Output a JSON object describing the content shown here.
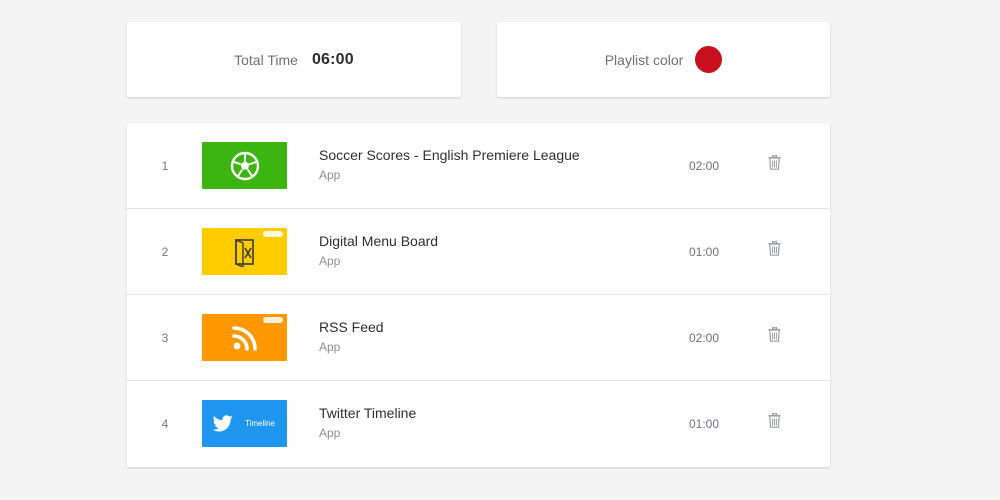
{
  "summary": {
    "total_time_label": "Total Time",
    "total_time_value": "06:00",
    "playlist_color_label": "Playlist color",
    "playlist_color": "#c8101e"
  },
  "playlist": [
    {
      "index": "1",
      "title": "Soccer Scores - English Premiere League",
      "type": "App",
      "duration": "02:00",
      "thumb_color": "#3cb511",
      "thumb_icon": "soccer-ball-icon",
      "featured": false,
      "thumb_text": ""
    },
    {
      "index": "2",
      "title": "Digital Menu Board",
      "type": "App",
      "duration": "01:00",
      "thumb_color": "#ffcc00",
      "thumb_icon": "menu-board-icon",
      "featured": true,
      "thumb_text": ""
    },
    {
      "index": "3",
      "title": "RSS Feed",
      "type": "App",
      "duration": "02:00",
      "thumb_color": "#ff9800",
      "thumb_icon": "rss-icon",
      "featured": true,
      "thumb_text": ""
    },
    {
      "index": "4",
      "title": "Twitter Timeline",
      "type": "App",
      "duration": "01:00",
      "thumb_color": "#1e96f0",
      "thumb_icon": "twitter-bird-icon",
      "featured": false,
      "thumb_text": "Timeline"
    }
  ],
  "icons": {
    "delete": "trash-icon"
  }
}
